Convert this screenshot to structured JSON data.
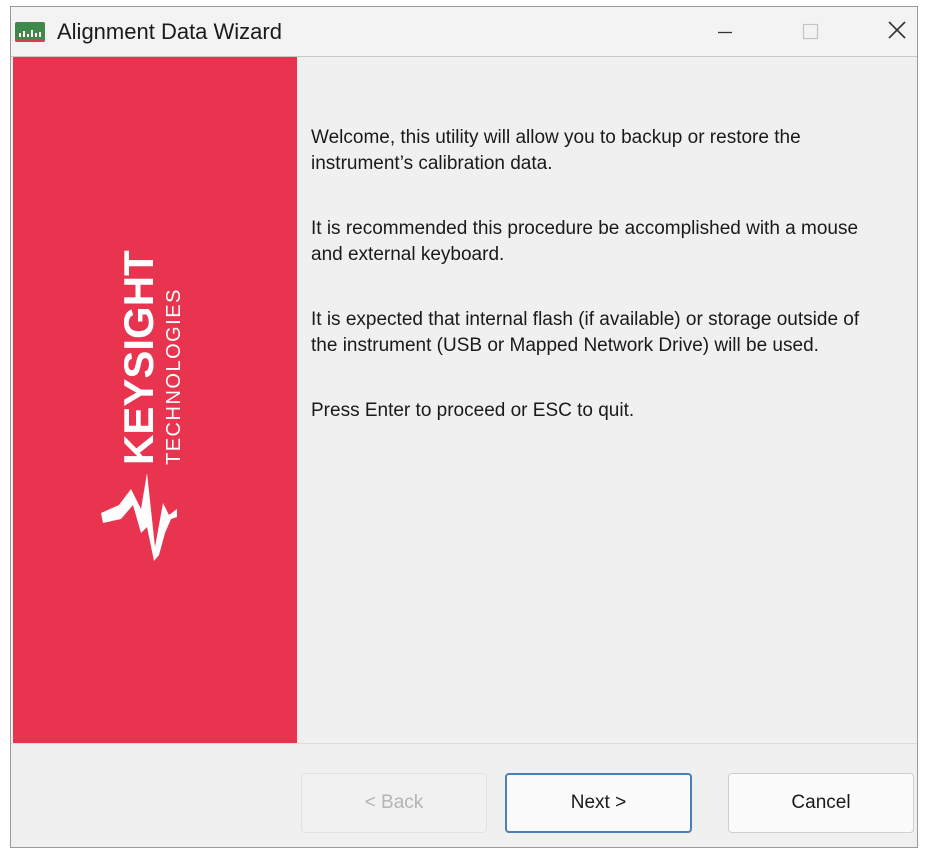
{
  "window": {
    "title": "Alignment Data Wizard",
    "controls": {
      "minimize_icon": "minimize-icon",
      "maximize_icon": "maximize-icon",
      "close_icon": "close-icon"
    }
  },
  "banner": {
    "brand": "KEYSIGHT",
    "subbrand": "TECHNOLOGIES",
    "background_color": "#e8344f",
    "logo_icon": "keysight-wave-logo"
  },
  "content": {
    "paragraphs": [
      "Welcome, this utility will allow you to backup or restore the\ninstrument’s calibration data.",
      "It is recommended this procedure be accomplished with a mouse\nand external keyboard.",
      "It is expected that internal flash (if available) or storage outside of\nthe instrument (USB or Mapped Network Drive) will be used.",
      "Press Enter to proceed or ESC to quit."
    ]
  },
  "buttons": {
    "back": {
      "label": "< Back",
      "enabled": false
    },
    "next": {
      "label": "Next >",
      "focused": true
    },
    "cancel": {
      "label": "Cancel"
    }
  }
}
